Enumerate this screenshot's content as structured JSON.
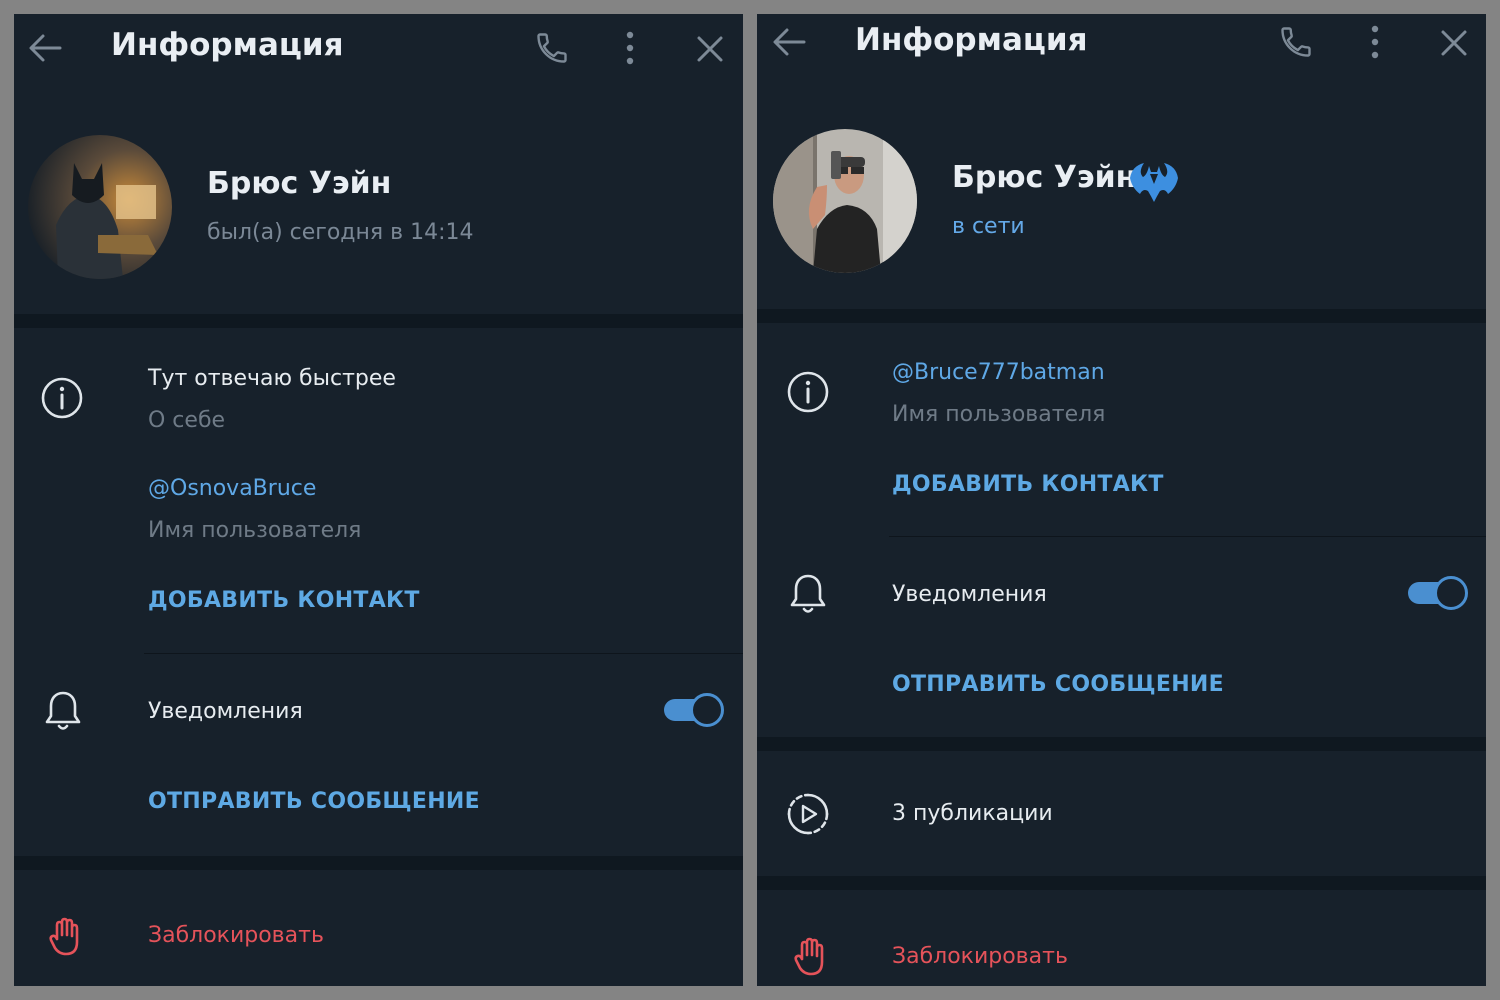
{
  "left": {
    "header": {
      "title": "Информация"
    },
    "profile": {
      "name": "Брюс Уэйн",
      "status": "был(а) сегодня в 14:14"
    },
    "info": {
      "bio": "Тут отвечаю быстрее",
      "bio_label": "О себе",
      "username": "@OsnovaBruce",
      "username_label": "Имя пользователя",
      "add_contact": "ДОБАВИТЬ КОНТАКТ"
    },
    "notifications": {
      "label": "Уведомления",
      "enabled": true,
      "send_message": "ОТПРАВИТЬ СООБЩЕНИЕ"
    },
    "block": {
      "label": "Заблокировать"
    }
  },
  "right": {
    "header": {
      "title": "Информация"
    },
    "profile": {
      "name": "Брюс Уэйн",
      "status": "в сети",
      "badge_icon": "bat-emoji-icon"
    },
    "info": {
      "username": "@Bruce777batman",
      "username_label": "Имя пользователя",
      "add_contact": "ДОБАВИТЬ КОНТАКТ"
    },
    "notifications": {
      "label": "Уведомления",
      "enabled": true,
      "send_message": "ОТПРАВИТЬ СООБЩЕНИЕ"
    },
    "stories": {
      "label": "3 публикации"
    },
    "block": {
      "label": "Заблокировать"
    }
  },
  "colors": {
    "panel_bg": "#17212b",
    "separator": "#0f1820",
    "accent": "#5ea9e4",
    "danger": "#e5535a",
    "icon": "#7d8a97"
  }
}
